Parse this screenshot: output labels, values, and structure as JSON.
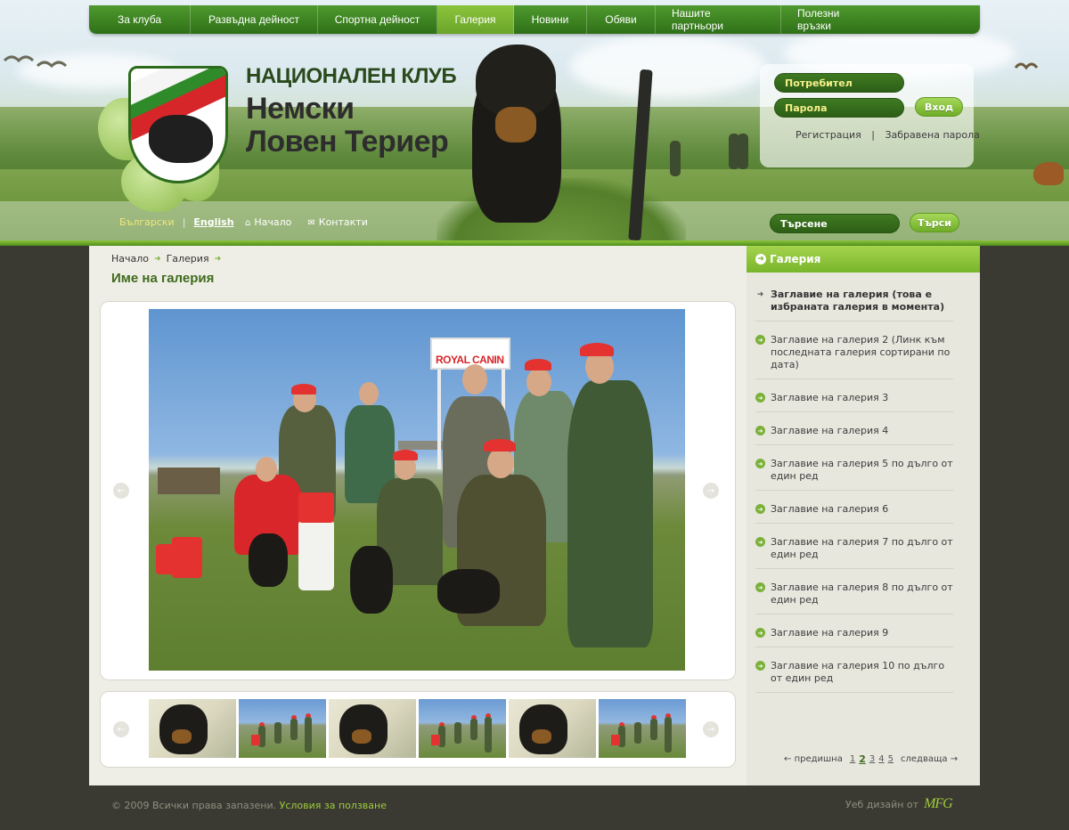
{
  "nav": {
    "items": [
      {
        "label": "За клуба",
        "active": false
      },
      {
        "label": "Развъдна дейност",
        "active": false
      },
      {
        "label": "Спортна дейност",
        "active": false
      },
      {
        "label": "Галерия",
        "active": true
      },
      {
        "label": "Новини",
        "active": false
      },
      {
        "label": "Обяви",
        "active": false
      },
      {
        "label": "Нашите партньори",
        "active": false
      },
      {
        "label": "Полезни връзки",
        "active": false
      }
    ]
  },
  "branding": {
    "line1": "НАЦИОНАЛЕН КЛУБ",
    "line2": "Немски",
    "line3": "Ловен Териер"
  },
  "login": {
    "username_placeholder": "Потребител",
    "password_placeholder": "Парола",
    "submit_label": "Вход",
    "register_link": "Регистрация",
    "separator": "|",
    "forgot_link": "Забравена парола"
  },
  "header_links": {
    "lang_bg": "Български",
    "lang_sep": "|",
    "lang_en": "English",
    "home": "Начало",
    "contacts": "Контакти"
  },
  "search": {
    "placeholder": "Търсене",
    "button_label": "Търси"
  },
  "breadcrumb": {
    "items": [
      "Начало",
      "Галерия"
    ]
  },
  "page_title": "Име на галерия",
  "photo": {
    "sign_text": "ROYAL CANIN"
  },
  "sidebar": {
    "title": "Галерия",
    "items": [
      {
        "label": "Заглавие на галерия (това е избраната галерия в момента)",
        "active": true
      },
      {
        "label": "Заглавие на галерия 2 (Линк към последната галерия сортирани по дата)",
        "active": false
      },
      {
        "label": "Заглавие на галерия 3",
        "active": false
      },
      {
        "label": "Заглавие на галерия 4",
        "active": false
      },
      {
        "label": "Заглавие на галерия 5 по дълго от един ред",
        "active": false
      },
      {
        "label": "Заглавие на галерия 6",
        "active": false
      },
      {
        "label": "Заглавие на галерия 7 по дълго от един ред",
        "active": false
      },
      {
        "label": "Заглавие на галерия 8 по дълго от един ред",
        "active": false
      },
      {
        "label": "Заглавие на галерия 9",
        "active": false
      },
      {
        "label": "Заглавие на галерия 10 по дълго от един ред",
        "active": false
      }
    ],
    "pager": {
      "prev_label": "предишна",
      "next_label": "следваща",
      "pages": [
        "1",
        "2",
        "3",
        "4",
        "5"
      ],
      "current": "2"
    }
  },
  "footer": {
    "copyright": "© 2009 Всички права запазени.",
    "terms_link": "Условия за ползване",
    "design_by": "Уеб дизайн  от",
    "designer_logo": "MFG"
  },
  "colors": {
    "nav_green": "#2f7018",
    "accent_lime": "#8bc43c",
    "title_green": "#3e6b1d",
    "page_bg": "#3a3a33"
  }
}
